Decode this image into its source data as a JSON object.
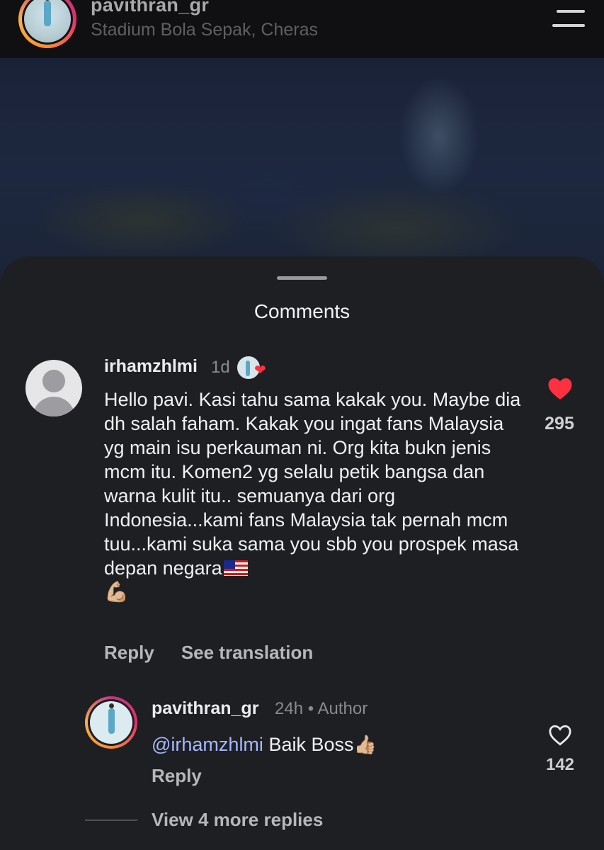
{
  "post": {
    "username": "pavithran_gr",
    "location": "Stadium Bola Sepak, Cheras"
  },
  "comments_sheet": {
    "title": "Comments",
    "comment": {
      "username": "irhamzhlmi",
      "time": "1d",
      "text": "Hello pavi. Kasi tahu sama kakak you. Maybe dia dh salah faham. Kakak you ingat fans Malaysia yg main isu perkauman ni. Org kita bukn jenis mcm itu. Komen2 yg selalu petik bangsa dan warna kulit itu.. semuanya dari org Indonesia...kami fans Malaysia tak pernah mcm tuu...kami suka sama you sbb you prospek masa depan negara",
      "flag_emoji": "🇲🇾",
      "flex_emoji": "💪🏼",
      "likes": "295",
      "reply_label": "Reply",
      "translate_label": "See translation"
    },
    "reply": {
      "username": "pavithran_gr",
      "time": "24h",
      "separator": "•",
      "author_label": "Author",
      "mention": "@irhamzhlmi",
      "text": "Baik Boss",
      "thumb_emoji": "👍🏼",
      "likes": "142",
      "reply_label": "Reply"
    },
    "view_more": "View 4 more replies"
  },
  "colors": {
    "heart_red": "#ff3040",
    "mention_blue": "#a6b8ff",
    "sheet_bg": "#1d1f23"
  }
}
